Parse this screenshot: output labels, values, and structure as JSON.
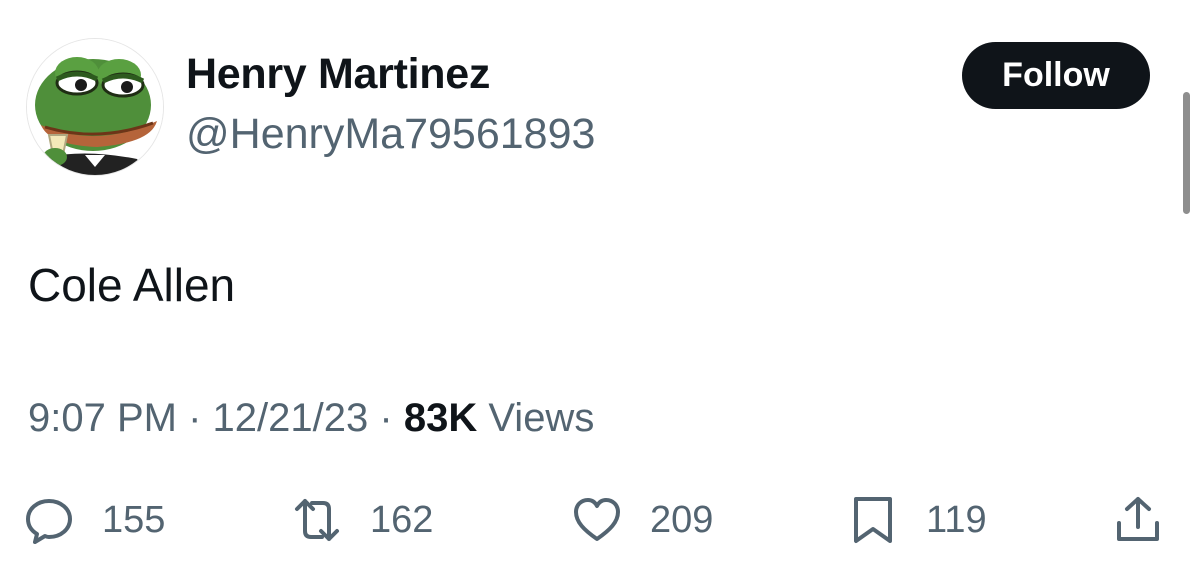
{
  "author": {
    "display_name": "Henry Martinez",
    "handle": "@HenryMa79561893",
    "avatar": "frog-avatar"
  },
  "header": {
    "follow_label": "Follow"
  },
  "tweet": {
    "text": "Cole Allen",
    "time": "9:07 PM",
    "separator": "·",
    "date": "12/21/23",
    "views_count": "83K",
    "views_label": "Views"
  },
  "actions": {
    "reply": {
      "icon": "reply-icon",
      "count": "155"
    },
    "retweet": {
      "icon": "retweet-icon",
      "count": "162"
    },
    "like": {
      "icon": "heart-icon",
      "count": "209"
    },
    "bookmark": {
      "icon": "bookmark-icon",
      "count": "119"
    },
    "share": {
      "icon": "share-icon"
    }
  },
  "colors": {
    "text_primary": "#0f1419",
    "text_secondary": "#536471",
    "follow_button_bg": "#0f1419",
    "follow_button_text": "#ffffff"
  }
}
